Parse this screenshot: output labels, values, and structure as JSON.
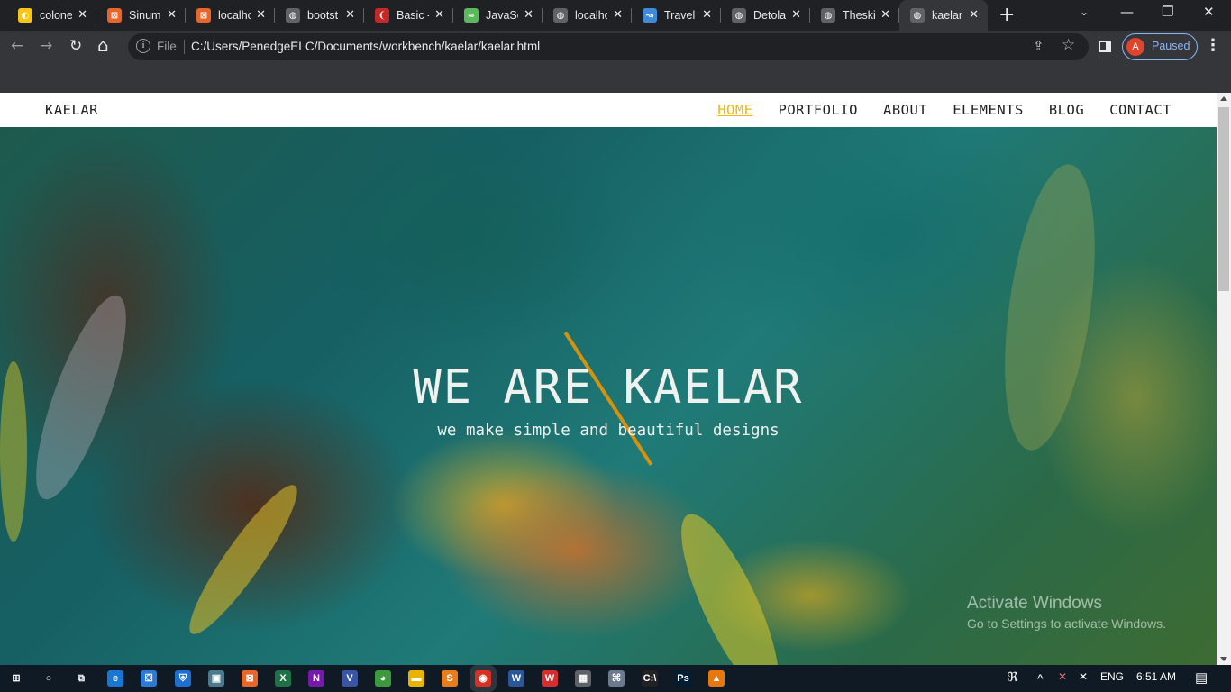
{
  "browser": {
    "tabs": [
      {
        "title": "colone",
        "fav_color": "#f5c518",
        "fav_glyph": "◐"
      },
      {
        "title": "Sinum",
        "fav_color": "#e8662a",
        "fav_glyph": "⊠"
      },
      {
        "title": "localho",
        "fav_color": "#e8662a",
        "fav_glyph": "⊠"
      },
      {
        "title": "bootst",
        "fav_color": "#5f6368",
        "fav_glyph": "◍"
      },
      {
        "title": "Basic -",
        "fav_color": "#c62828",
        "fav_glyph": "❨"
      },
      {
        "title": "JavaSc",
        "fav_color": "#5cb85c",
        "fav_glyph": "≈"
      },
      {
        "title": "localho",
        "fav_color": "#5f6368",
        "fav_glyph": "◍"
      },
      {
        "title": "Travel",
        "fav_color": "#3d8bd9",
        "fav_glyph": "↝"
      },
      {
        "title": "Detola",
        "fav_color": "#5f6368",
        "fav_glyph": "◍"
      },
      {
        "title": "Theski",
        "fav_color": "#5f6368",
        "fav_glyph": "◍"
      },
      {
        "title": "kaelar",
        "fav_color": "#5f6368",
        "fav_glyph": "◍",
        "active": true
      }
    ],
    "new_tab": "+",
    "tab_search": "⌄",
    "window": {
      "minimize": "—",
      "maximize": "❐",
      "close": "✕"
    },
    "nav": {
      "back": "←",
      "forward": "→",
      "reload": "↻",
      "home": "⌂"
    },
    "omnibox": {
      "info": "i",
      "scheme": "File",
      "url": "C:/Users/PenedgeELC/Documents/workbench/kaelar/kaelar.html",
      "share": "⇪",
      "bookmark": "☆"
    },
    "profile": {
      "initial": "A",
      "status": "Paused"
    },
    "menu": "⋮"
  },
  "site": {
    "brand": "KAELAR",
    "nav": [
      {
        "label": "HOME",
        "active": true
      },
      {
        "label": "PORTFOLIO"
      },
      {
        "label": "ABOUT"
      },
      {
        "label": "ELEMENTS"
      },
      {
        "label": "BLOG"
      },
      {
        "label": "CONTACT"
      }
    ],
    "hero": {
      "title": "WE ARE KAELAR",
      "subtitle": "we make simple and beautiful designs",
      "accent": "#d4920f"
    },
    "active_link_color": "#f0b90b"
  },
  "watermark": {
    "line1": "Activate Windows",
    "line2": "Go to Settings to activate Windows."
  },
  "taskbar": {
    "apps": [
      {
        "name": "windows-start",
        "glyph": "⊞",
        "color": "#101a24"
      },
      {
        "name": "search",
        "glyph": "○",
        "color": "#101a24"
      },
      {
        "name": "task-view",
        "glyph": "⧉",
        "color": "#101a24"
      },
      {
        "name": "edge",
        "glyph": "e",
        "color": "#1877d2"
      },
      {
        "name": "store",
        "glyph": "⛋",
        "color": "#2b7bd6"
      },
      {
        "name": "defender",
        "glyph": "⛨",
        "color": "#1e6fd0"
      },
      {
        "name": "photos",
        "glyph": "▣",
        "color": "#4a7a8c"
      },
      {
        "name": "xampp",
        "glyph": "⊠",
        "color": "#e8662a"
      },
      {
        "name": "excel",
        "glyph": "X",
        "color": "#1e7145"
      },
      {
        "name": "onenote",
        "glyph": "N",
        "color": "#7719aa"
      },
      {
        "name": "visio",
        "glyph": "V",
        "color": "#3955a3"
      },
      {
        "name": "app-green",
        "glyph": "◕",
        "color": "#3c9a3c"
      },
      {
        "name": "file-explorer",
        "glyph": "▬",
        "color": "#e8b400"
      },
      {
        "name": "sublime",
        "glyph": "S",
        "color": "#e87d1e"
      },
      {
        "name": "chrome",
        "glyph": "◉",
        "color": "#d93025",
        "active": true
      },
      {
        "name": "word",
        "glyph": "W",
        "color": "#2b579a"
      },
      {
        "name": "wps",
        "glyph": "W",
        "color": "#d32f2f"
      },
      {
        "name": "calculator",
        "glyph": "▦",
        "color": "#5f6368"
      },
      {
        "name": "network-app",
        "glyph": "⌘",
        "color": "#6b7a8c"
      },
      {
        "name": "cmd",
        "glyph": "C:\\",
        "color": "#222"
      },
      {
        "name": "photoshop",
        "glyph": "Ps",
        "color": "#001d34"
      },
      {
        "name": "vlc",
        "glyph": "▲",
        "color": "#e8770e"
      }
    ],
    "tray": {
      "people": "ℜ",
      "chevron": "^",
      "network": "✕",
      "volume": "✕",
      "lang": "ENG",
      "time": "6:51 AM",
      "notifications": "▤"
    }
  }
}
